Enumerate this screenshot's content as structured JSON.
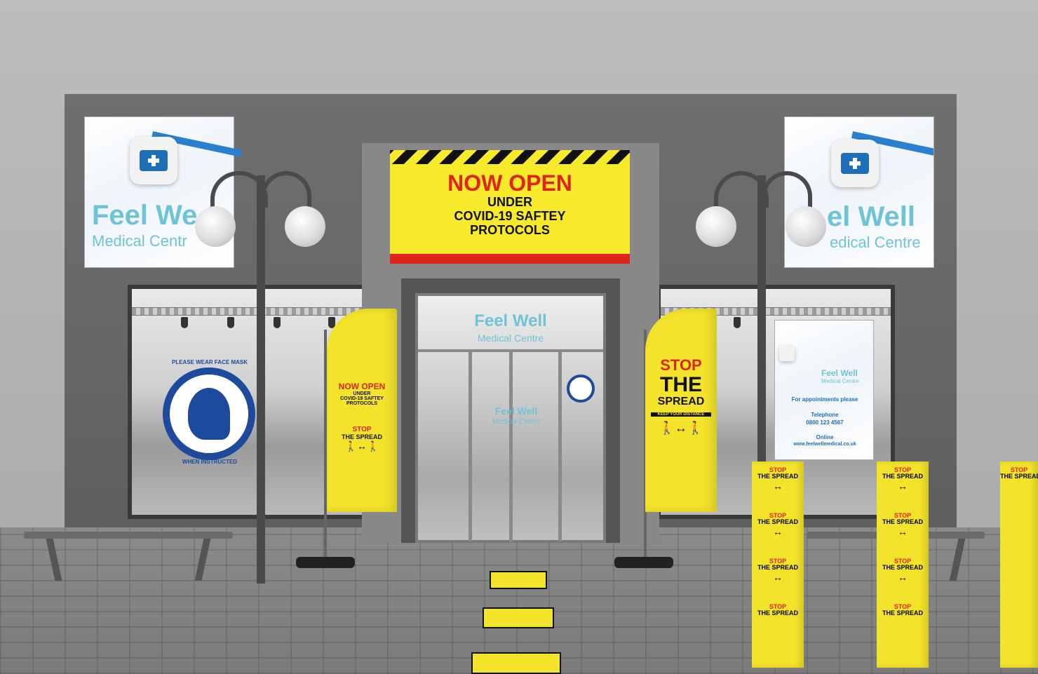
{
  "banner": {
    "line1": "NOW OPEN",
    "line2": "UNDER",
    "line3": "COVID-19 SAFTEY",
    "line4": "PROTOCOLS"
  },
  "brand": {
    "name": "Feel Well",
    "sub": "Medical Centre",
    "left_name": "Feel We",
    "left_sub": "Medical Centr",
    "right_name": "el Well",
    "right_sub": "edical Centre"
  },
  "mask_sign": {
    "top": "PLEASE WEAR FACE MASK",
    "bottom": "WHEN INSTRUCTED"
  },
  "flag_left": {
    "line1": "NOW OPEN",
    "line2": "UNDER",
    "line3": "COVID-19 SAFTEY",
    "line4": "PROTOCOLS",
    "stop": "STOP",
    "spread": "THE SPREAD"
  },
  "flag_right": {
    "stop": "STOP",
    "the": "THE",
    "spread": "SPREAD",
    "distance": "KEEP YOUR DISTANCE"
  },
  "poster": {
    "name": "Feel Well",
    "sub": "Medical Centre",
    "appointments": "For appointments please",
    "telephone_label": "Telephone",
    "telephone": "0800 123 4567",
    "online_label": "Online",
    "website": "www.feelwellmedical.co.uk"
  },
  "pillar": {
    "stop": "STOP",
    "spread": "THE SPREAD"
  },
  "colors": {
    "yellow": "#f3e32a",
    "red": "#e0241b",
    "brand_blue": "#6ec3d6",
    "navy": "#1d4a9c"
  }
}
